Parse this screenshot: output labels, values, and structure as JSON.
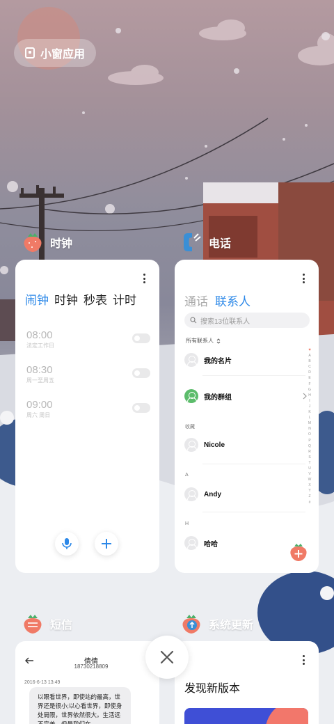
{
  "small_window_button": {
    "label": "小窗应用",
    "icon": "small-window-icon"
  },
  "apps": {
    "clock": {
      "name": "时钟",
      "tabs": [
        "闹钟",
        "时钟",
        "秒表",
        "计时"
      ],
      "active_tab": "闹钟",
      "alarms": [
        {
          "time": "08:00",
          "desc": "法定工作日",
          "enabled": false
        },
        {
          "time": "08:30",
          "desc": "周一至周五",
          "enabled": false
        },
        {
          "time": "09:00",
          "desc": "周六 周日",
          "enabled": false
        }
      ],
      "accent": "#2c88e8"
    },
    "phone": {
      "name": "电话",
      "tabs": [
        "通话",
        "联系人"
      ],
      "active_tab": "联系人",
      "search_placeholder": "搜索13位联系人",
      "all_contacts_label": "所有联系人",
      "my_card": "我的名片",
      "my_groups": "我的群组",
      "favorites_label": "收藏",
      "favorites": [
        "Nicole"
      ],
      "section_a": "A",
      "contact_a": "Andy",
      "section_h": "H",
      "contact_h": "哈哈",
      "alphabet": [
        "A",
        "B",
        "C",
        "D",
        "E",
        "F",
        "G",
        "H",
        "I",
        "J",
        "K",
        "L",
        "M",
        "N",
        "O",
        "P",
        "Q",
        "R",
        "S",
        "T",
        "U",
        "V",
        "W",
        "X",
        "Y",
        "Z",
        "#"
      ]
    },
    "sms": {
      "name": "短信",
      "contact_name": "倩倩",
      "contact_number": "18730218809",
      "date": "2016-6-13 13:49",
      "message": "以眼看世界，即使站的最高，世界还是很小;以心看世界，即使身处局限，世界依然很大。生活远不完美，但是我们在"
    },
    "update": {
      "name": "系统更新",
      "title": "发现新版本"
    }
  },
  "close_button": {
    "icon": "close-icon"
  },
  "colors": {
    "accent": "#2c88e8",
    "strawberry": "#f07a66",
    "group_green": "#5cbc6b"
  }
}
